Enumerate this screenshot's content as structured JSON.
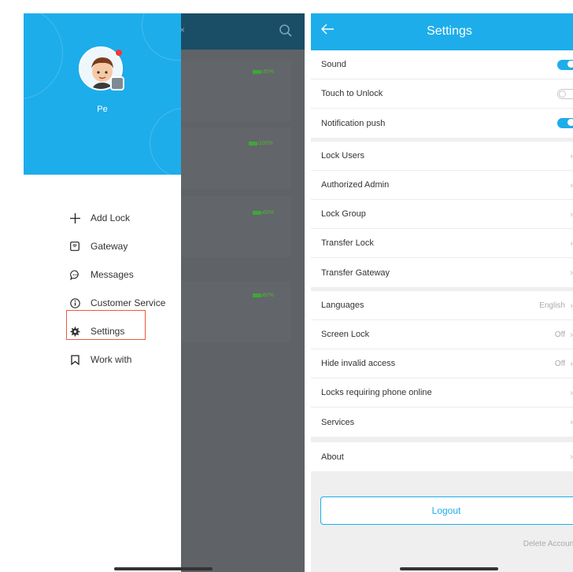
{
  "left": {
    "user_name": "Pe",
    "menu": [
      {
        "label": "Add Lock",
        "icon": "plus-icon"
      },
      {
        "label": "Gateway",
        "icon": "gateway-icon"
      },
      {
        "label": "Messages",
        "icon": "message-icon"
      },
      {
        "label": "Customer Service",
        "icon": "info-icon"
      },
      {
        "label": "Settings",
        "icon": "gear-icon"
      },
      {
        "label": "Work with",
        "icon": "bookmark-icon"
      }
    ],
    "overlay": {
      "close_glyph": "×",
      "batteries": [
        "35%",
        "100%",
        "60%",
        "80%"
      ]
    },
    "colors": {
      "accent": "#1dadea",
      "highlight": "#ee5a3c"
    }
  },
  "right": {
    "title": "Settings",
    "toggles": [
      {
        "label": "Sound",
        "state": "on"
      },
      {
        "label": "Touch to Unlock",
        "state": "off"
      },
      {
        "label": "Notification push",
        "state": "on"
      }
    ],
    "lock_items": [
      "Lock Users",
      "Authorized Admin",
      "Lock Group",
      "Transfer Lock",
      "Transfer Gateway"
    ],
    "pref_items": [
      {
        "label": "Languages",
        "value": "English"
      },
      {
        "label": "Screen Lock",
        "value": "Off"
      },
      {
        "label": "Hide invalid access",
        "value": "Off"
      },
      {
        "label": "Locks requiring phone online",
        "value": ""
      },
      {
        "label": "Services",
        "value": ""
      }
    ],
    "about_label": "About",
    "logout_label": "Logout",
    "delete_account_label": "Delete Account"
  }
}
